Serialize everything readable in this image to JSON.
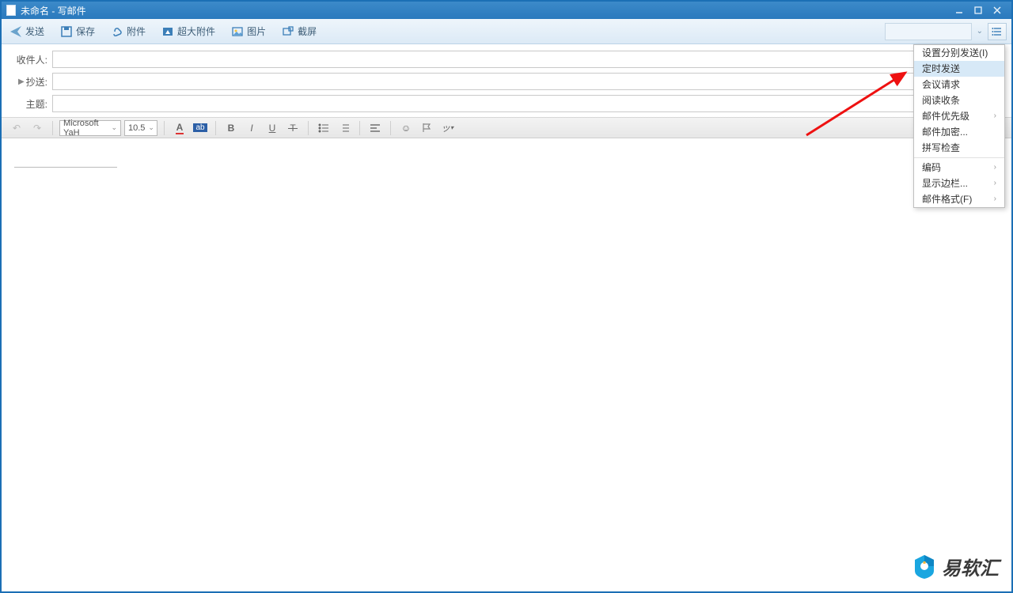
{
  "window": {
    "title": "未命名 - 写邮件"
  },
  "toolbar": {
    "send": "发送",
    "save": "保存",
    "attach": "附件",
    "big_attach": "超大附件",
    "image": "图片",
    "screenshot": "截屏"
  },
  "fields": {
    "to_label": "收件人:",
    "cc_label": "抄送:",
    "subject_label": "主题:",
    "to_value": "",
    "cc_value": "",
    "subject_value": ""
  },
  "format": {
    "font": "Microsoft YaH",
    "size": "10.5"
  },
  "dropdown": {
    "items": [
      {
        "label": "设置分别发送(I)"
      },
      {
        "label": "定时发送",
        "highlight": true
      },
      {
        "label": "会议请求"
      },
      {
        "label": "阅读收条"
      },
      {
        "label": "邮件优先级",
        "submenu": true
      },
      {
        "label": "邮件加密..."
      },
      {
        "label": "拼写检查"
      },
      {
        "sep": true
      },
      {
        "label": "编码",
        "submenu": true
      },
      {
        "label": "显示边栏...",
        "submenu": true
      },
      {
        "label": "邮件格式(F)",
        "submenu": true
      }
    ]
  },
  "watermark": {
    "text": "易软汇"
  }
}
